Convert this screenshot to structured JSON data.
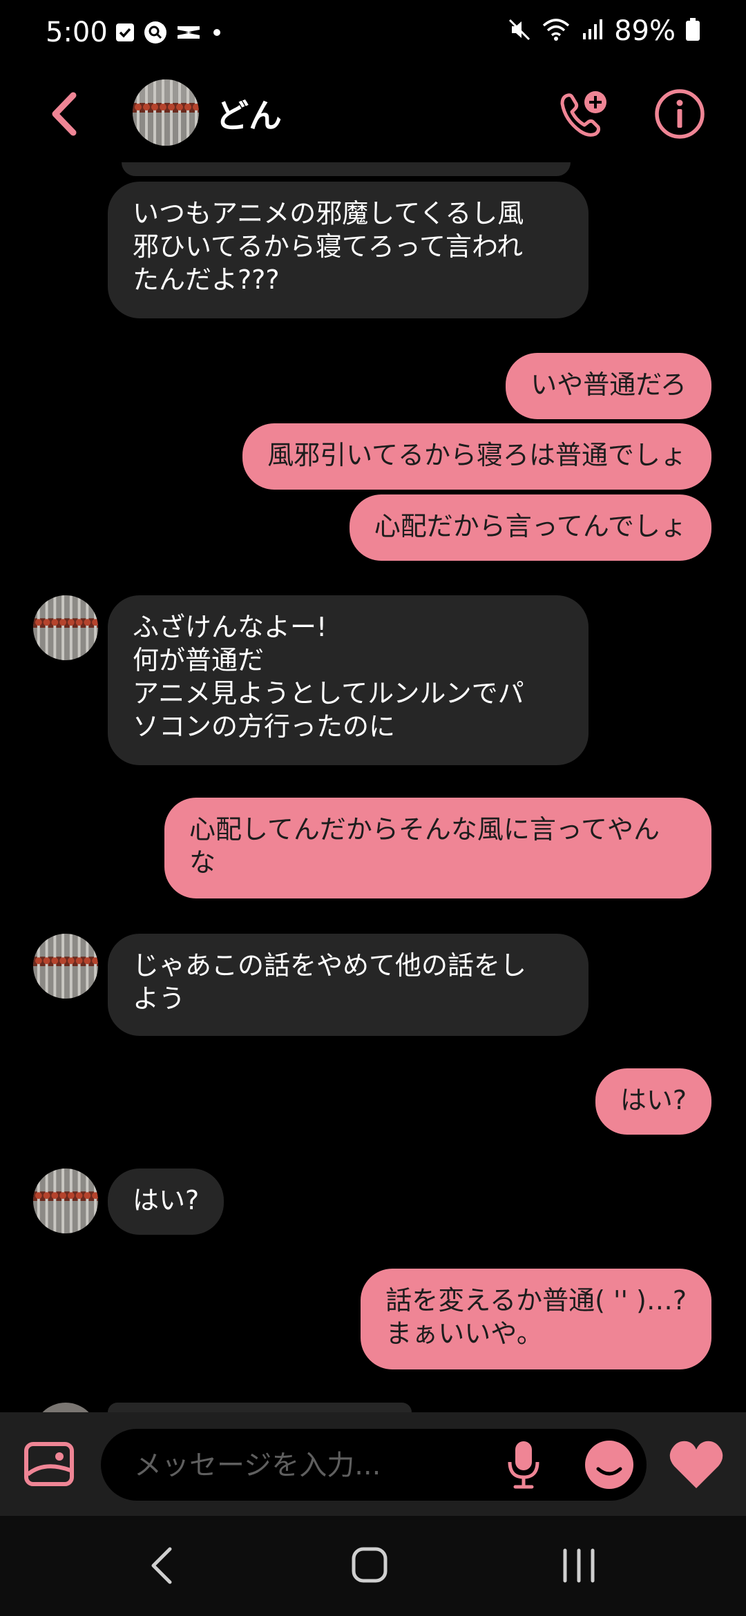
{
  "status_bar": {
    "time": "5:00",
    "battery": "89%",
    "left_icons": [
      "checkbox-notification-icon",
      "search-notification-icon",
      "capcut-notification-icon",
      "dot-icon"
    ],
    "right_icons": [
      "mute-icon",
      "wifi-icon",
      "signal-icon",
      "battery-icon"
    ]
  },
  "header": {
    "contact_name": "どん",
    "icons": [
      "back-arrow-icon",
      "video-call-add-icon",
      "info-icon"
    ]
  },
  "colors": {
    "accent": "#ef8595",
    "incoming_bubble": "#262626",
    "background": "#000000",
    "composer_bg": "#1f1f1f"
  },
  "messages": [
    {
      "direction": "in",
      "text": "いつもアニメの邪魔してくるし風\n邪ひいてるから寝てろって言われ\nたんだよ???"
    },
    {
      "direction": "out",
      "text": "いや普通だろ"
    },
    {
      "direction": "out",
      "text": "風邪引いてるから寝ろは普通でしょ"
    },
    {
      "direction": "out",
      "text": "心配だから言ってんでしょ"
    },
    {
      "direction": "in",
      "text": "ふざけんなよー!\n何が普通だ\nアニメ見ようとしてルンルンでパ\nソコンの方行ったのに"
    },
    {
      "direction": "out",
      "text": "心配してんだからそんな風に言ってやん\nな"
    },
    {
      "direction": "in",
      "text": "じゃあこの話をやめて他の話をし\nよう"
    },
    {
      "direction": "out",
      "text": "はい?"
    },
    {
      "direction": "in",
      "text": "はい?"
    },
    {
      "direction": "out",
      "text": "話を変えるか普通(  '' )…?\nまぁいいや。"
    }
  ],
  "composer": {
    "placeholder": "メッセージを入力...",
    "icons": [
      "gallery-icon",
      "mic-icon",
      "emoji-icon",
      "heart-icon"
    ]
  },
  "nav_bar": {
    "icons": [
      "nav-back-icon",
      "nav-home-icon",
      "nav-recents-icon"
    ]
  }
}
